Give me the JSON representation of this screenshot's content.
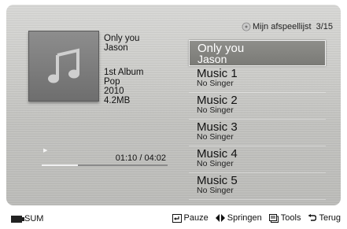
{
  "header": {
    "playlist_label": "Mijn afspeellijst",
    "counter": "3/15"
  },
  "now_playing": {
    "title": "Only you",
    "artist": "Jason",
    "album": "1st Album",
    "genre": "Pop",
    "year": "2010",
    "size": "4.2MB",
    "time": "01:10 / 04:02",
    "progress_fraction": 0.29
  },
  "songs": [
    {
      "title": "Only you",
      "singer": "Jason",
      "selected": true
    },
    {
      "title": "Music 1",
      "singer": "No Singer"
    },
    {
      "title": "Music 2",
      "singer": "No Singer"
    },
    {
      "title": "Music 3",
      "singer": "No Singer"
    },
    {
      "title": "Music 4",
      "singer": "No Singer"
    },
    {
      "title": "Music 5",
      "singer": "No Singer"
    }
  ],
  "bottom_bar": {
    "sum_label": "SUM",
    "pause_label": "Pauze",
    "jump_label": "Springen",
    "tools_label": "Tools",
    "back_label": "Terug"
  },
  "icons": {
    "cover": "music-note-icon",
    "playlist": "playlist-disc-icon",
    "pause": "enter-icon",
    "jump": "left-right-arrows-icon",
    "tools": "tools-icon",
    "back": "return-icon"
  }
}
